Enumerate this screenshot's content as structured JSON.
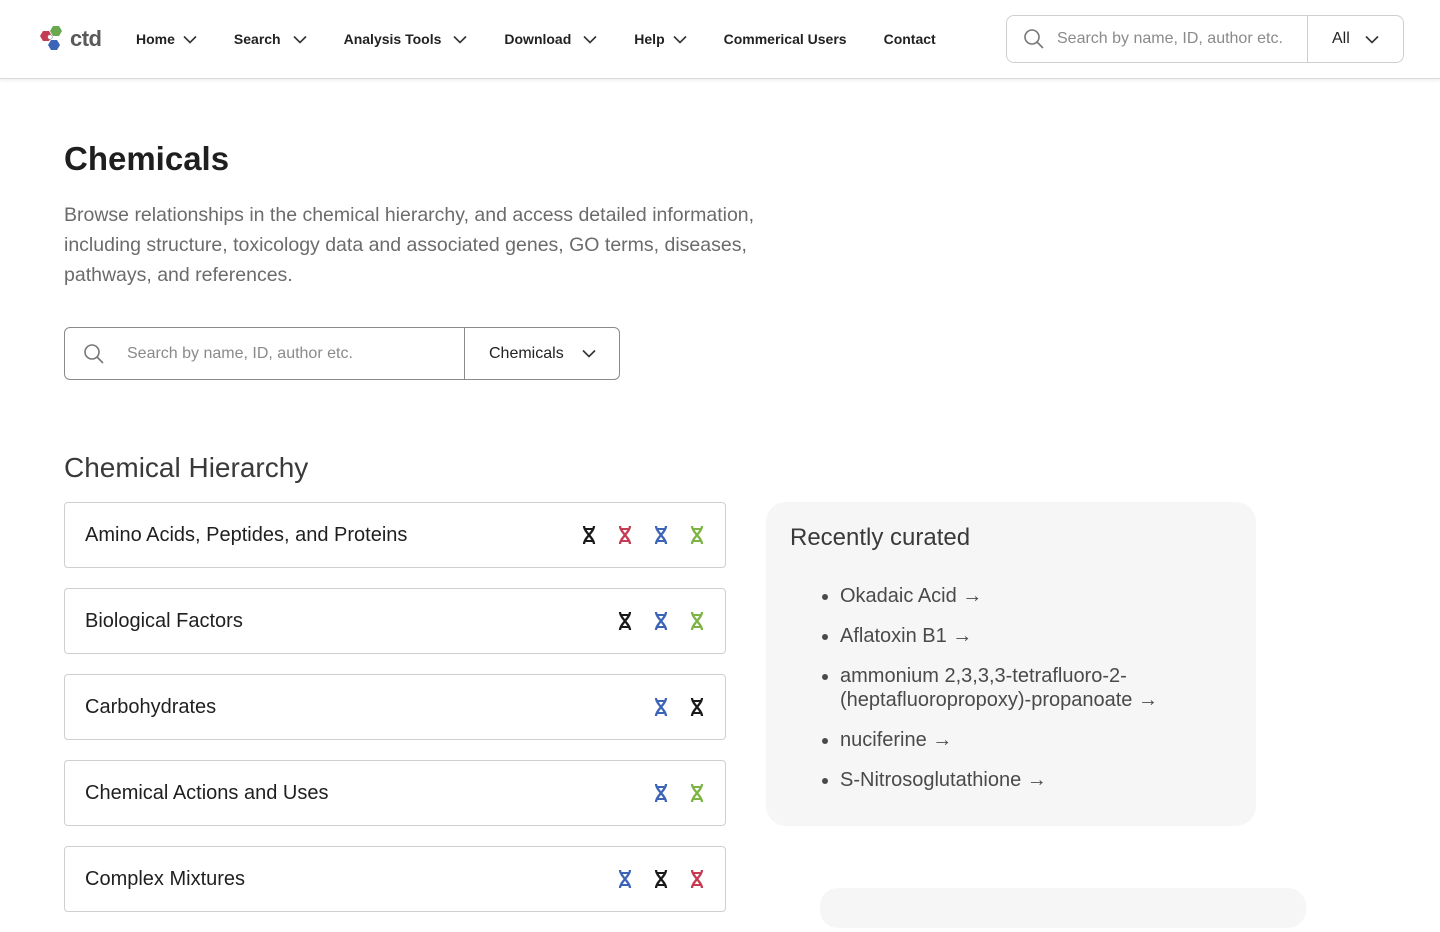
{
  "brand": {
    "logo_text": "ctd",
    "colors": {
      "red": "#c43b52",
      "green": "#6aa84f",
      "blue": "#3b64b8"
    }
  },
  "nav": {
    "items": [
      {
        "label": "Home",
        "has_dropdown": true
      },
      {
        "label": "Search",
        "has_dropdown": true
      },
      {
        "label": "Analysis Tools",
        "has_dropdown": true
      },
      {
        "label": "Download",
        "has_dropdown": true
      },
      {
        "label": "Help",
        "has_dropdown": true
      },
      {
        "label": "Commerical Users",
        "has_dropdown": false
      },
      {
        "label": "Contact",
        "has_dropdown": false
      }
    ]
  },
  "top_search": {
    "placeholder": "Search by name, ID, author etc.",
    "scope": "All"
  },
  "page": {
    "title": "Chemicals",
    "description": "Browse relationships in the chemical hierarchy, and access detailed information, including structure, toxicology data and associated genes, GO terms, diseases, pathways, and references."
  },
  "main_search": {
    "placeholder": "Search by name, ID, author etc.",
    "scope": "Chemicals"
  },
  "hierarchy": {
    "title": "Chemical Hierarchy",
    "items": [
      {
        "label": "Amino Acids, Peptides, and Proteins",
        "icons": [
          "dna-black",
          "dna-red",
          "dna-blue",
          "dna-green"
        ]
      },
      {
        "label": "Biological Factors",
        "icons": [
          "dna-black",
          "dna-blue",
          "dna-green"
        ]
      },
      {
        "label": "Carbohydrates",
        "icons": [
          "dna-blue",
          "dna-black"
        ]
      },
      {
        "label": "Chemical Actions and Uses",
        "icons": [
          "dna-blue",
          "dna-green"
        ]
      },
      {
        "label": "Complex Mixtures",
        "icons": [
          "dna-blue",
          "dna-black",
          "dna-red"
        ]
      }
    ],
    "icon_colors": {
      "dna-black": "#1a1a1a",
      "dna-red": "#c43b52",
      "dna-blue": "#3b64b8",
      "dna-green": "#7cb342"
    }
  },
  "recently_curated": {
    "title": "Recently curated",
    "items": [
      "Okadaic Acid →",
      "Aflatoxin B1 →",
      "ammonium 2,3,3,3-tetrafluoro-2-(heptafluoropropoxy)-propanoate →",
      "nuciferine →",
      "S-Nitrosoglutathione →"
    ]
  }
}
